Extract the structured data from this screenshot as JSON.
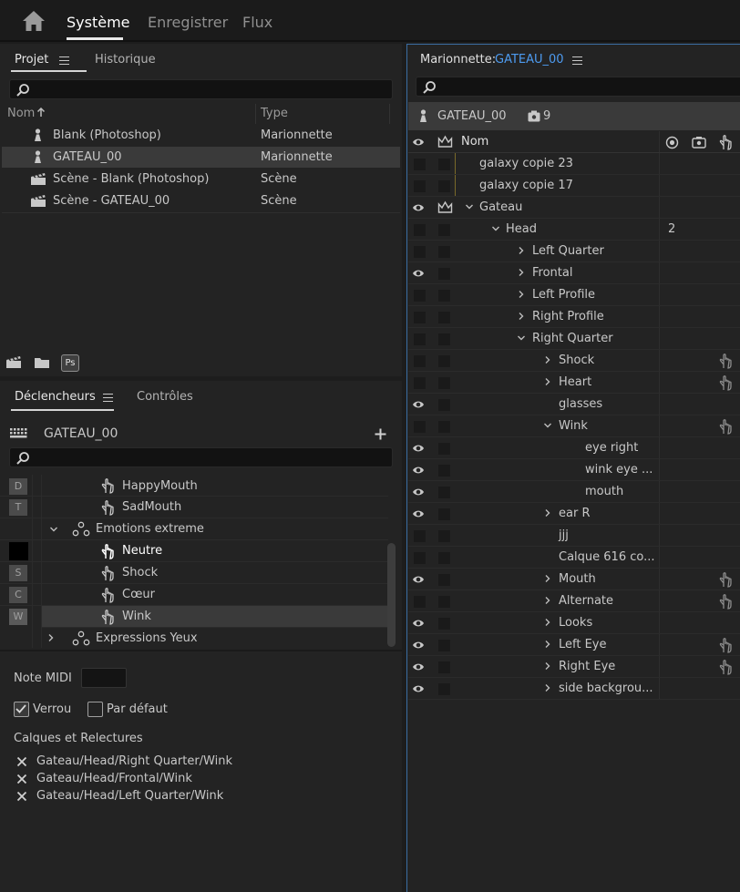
{
  "topbar": {
    "tabs": [
      "Système",
      "Enregistrer",
      "Flux"
    ]
  },
  "project_panel": {
    "tabs": [
      "Projet",
      "Historique"
    ],
    "col_name": "Nom",
    "col_type": "Type",
    "items": [
      {
        "name": "Blank (Photoshop)",
        "type": "Marionnette",
        "icon": "puppet-icon"
      },
      {
        "name": "GATEAU_00",
        "type": "Marionnette",
        "icon": "puppet-icon"
      },
      {
        "name": "Scène - Blank (Photoshop)",
        "type": "Scène",
        "icon": "scene-icon"
      },
      {
        "name": "Scène - GATEAU_00",
        "type": "Scène",
        "icon": "scene-icon"
      }
    ],
    "footer_ps": "Ps"
  },
  "triggers_panel": {
    "tabs": [
      "Déclencheurs",
      "Contrôles"
    ],
    "puppet": "GATEAU_00",
    "rows": [
      {
        "key": "D",
        "label": "HappyMouth"
      },
      {
        "key": "T",
        "label": "SadMouth"
      },
      {
        "key": "",
        "label": "Emotions extreme"
      },
      {
        "key": "",
        "label": "Neutre"
      },
      {
        "key": "S",
        "label": "Shock"
      },
      {
        "key": "C",
        "label": "Cœur"
      },
      {
        "key": "W",
        "label": "Wink"
      },
      {
        "key": "",
        "label": "Expressions Yeux"
      }
    ],
    "midi_label": "Note MIDI",
    "lock_label": "Verrou",
    "default_label": "Par défaut",
    "layers_title": "Calques et Relectures",
    "layers": [
      "Gateau/Head/Right Quarter/Wink",
      "Gateau/Head/Frontal/Wink",
      "Gateau/Head/Left Quarter/Wink"
    ]
  },
  "puppet_panel": {
    "title_prefix": "Marionnette:",
    "title_puppet": "GATEAU_00",
    "puppet_name": "GATEAU_00",
    "count": "9",
    "col_name": "Nom",
    "rows": [
      {
        "label": "galaxy copie 23",
        "value": ""
      },
      {
        "label": "galaxy copie 17",
        "value": ""
      },
      {
        "label": "Gateau",
        "value": ""
      },
      {
        "label": "Head",
        "value": "2"
      },
      {
        "label": "Left Quarter",
        "value": ""
      },
      {
        "label": "Frontal",
        "value": ""
      },
      {
        "label": "Left Profile",
        "value": ""
      },
      {
        "label": "Right Profile",
        "value": ""
      },
      {
        "label": "Right Quarter",
        "value": ""
      },
      {
        "label": "Shock",
        "value": ""
      },
      {
        "label": "Heart",
        "value": ""
      },
      {
        "label": "glasses",
        "value": ""
      },
      {
        "label": "Wink",
        "value": ""
      },
      {
        "label": "eye right",
        "value": ""
      },
      {
        "label": "wink eye ...",
        "value": ""
      },
      {
        "label": "mouth",
        "value": ""
      },
      {
        "label": "ear R",
        "value": ""
      },
      {
        "label": "jjj",
        "value": ""
      },
      {
        "label": "Calque 616 co...",
        "value": ""
      },
      {
        "label": "Mouth",
        "value": ""
      },
      {
        "label": "Alternate",
        "value": ""
      },
      {
        "label": "Looks",
        "value": ""
      },
      {
        "label": "Left Eye",
        "value": ""
      },
      {
        "label": "Right Eye",
        "value": ""
      },
      {
        "label": "side backgrou...",
        "value": ""
      }
    ]
  },
  "colors": {
    "accent_blue": "#4d9bf0",
    "panel_bg": "#232323",
    "selected_row": "#3a3a3a"
  }
}
